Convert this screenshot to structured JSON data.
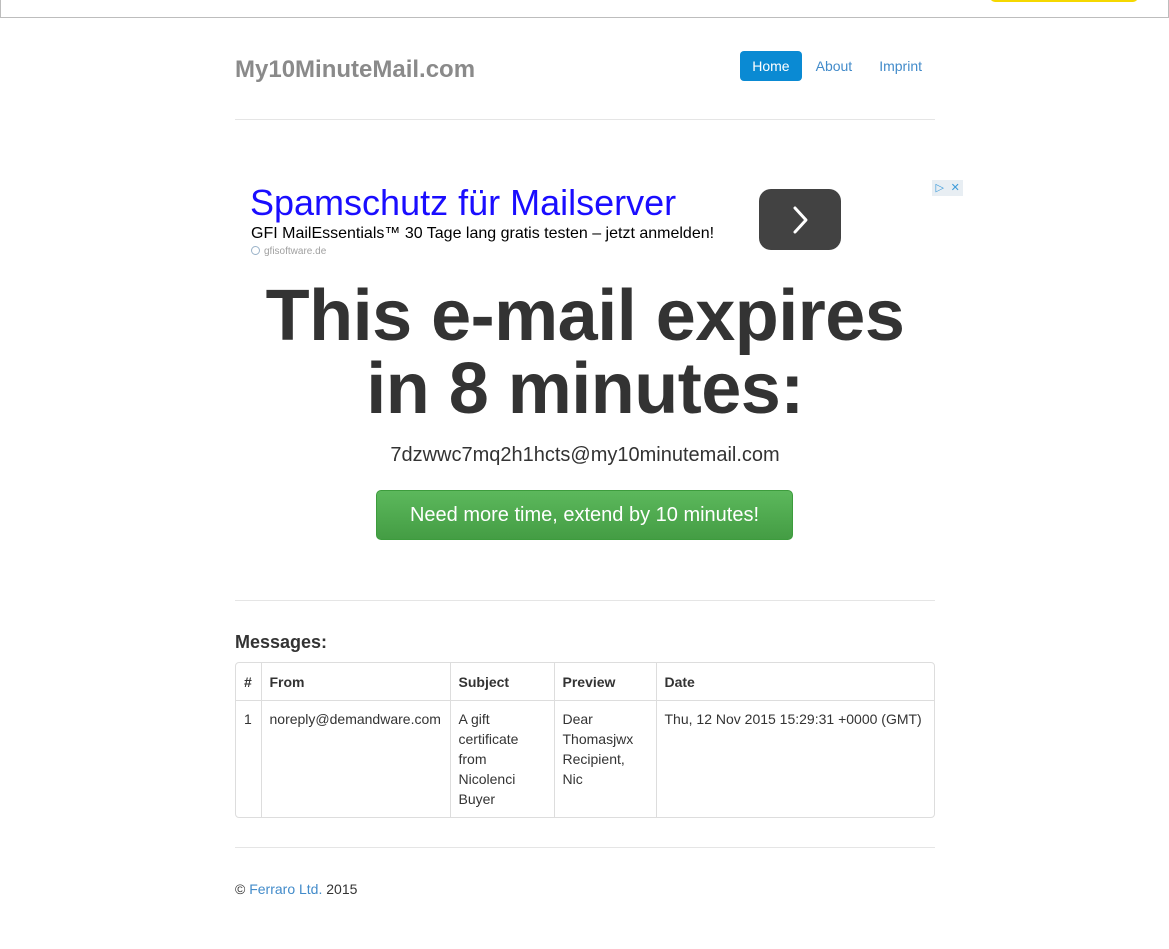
{
  "brand": "My10MinuteMail.com",
  "nav": [
    {
      "label": "Home",
      "active": true
    },
    {
      "label": "About",
      "active": false
    },
    {
      "label": "Imprint",
      "active": false
    }
  ],
  "ad": {
    "title": "Spamschutz für Mailserver",
    "subtitle": "GFI MailEssentials™ 30 Tage lang gratis testen – jetzt anmelden!",
    "domain": "gfisoftware.de",
    "arrow_icon": "chevron-right-icon",
    "choices_icons": [
      "adchoices-icon",
      "close-icon"
    ]
  },
  "hero": {
    "line1": "This e-mail expires",
    "line2": "in 8 minutes:"
  },
  "email_address": "7dzwwc7mq2h1hcts@my10minutemail.com",
  "extend_button": "Need more time, extend by 10 minutes!",
  "messages": {
    "title": "Messages:",
    "columns": [
      "#",
      "From",
      "Subject",
      "Preview",
      "Date"
    ],
    "rows": [
      {
        "num": "1",
        "from": "noreply@demandware.com",
        "subject": "A gift certificate from Nicolenci Buyer",
        "preview": "Dear Thomasjwx Recipient, Nic",
        "date": "Thu, 12 Nov 2015 15:29:31 +0000 (GMT)"
      }
    ]
  },
  "footer": {
    "copyright": "©",
    "company": "Ferraro Ltd.",
    "year": "2015"
  },
  "colors": {
    "primary": "#0a8ad3",
    "link": "#428bca",
    "success": "#5cb85c",
    "ad_title": "#1a0dff"
  }
}
